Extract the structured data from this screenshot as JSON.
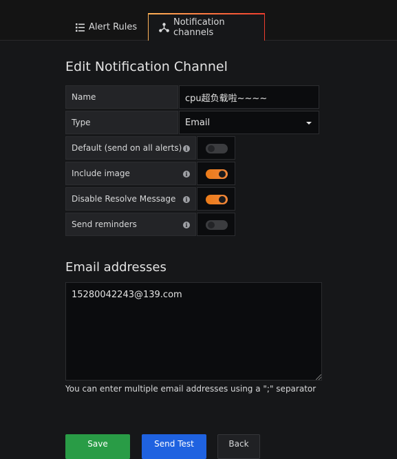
{
  "tabs": {
    "alert_rules": "Alert Rules",
    "notification_channels": "Notification channels"
  },
  "page_title": "Edit Notification Channel",
  "form": {
    "name_label": "Name",
    "name_value": "cpu超负载啦~~~~",
    "type_label": "Type",
    "type_value": "Email",
    "default_label": "Default (send on all alerts)",
    "default_on": false,
    "include_image_label": "Include image",
    "include_image_on": true,
    "disable_resolve_label": "Disable Resolve Message",
    "disable_resolve_on": true,
    "send_reminders_label": "Send reminders",
    "send_reminders_on": false,
    "info_glyph": "i"
  },
  "email": {
    "section_title": "Email addresses",
    "value": "15280042243@139.com",
    "help": "You can enter multiple email addresses using a \";\" separator"
  },
  "buttons": {
    "save": "Save",
    "send_test": "Send Test",
    "back": "Back"
  },
  "colors": {
    "accent_orange": "#eb7b18",
    "save_green": "#299c46",
    "send_test_blue": "#1f62e0"
  }
}
